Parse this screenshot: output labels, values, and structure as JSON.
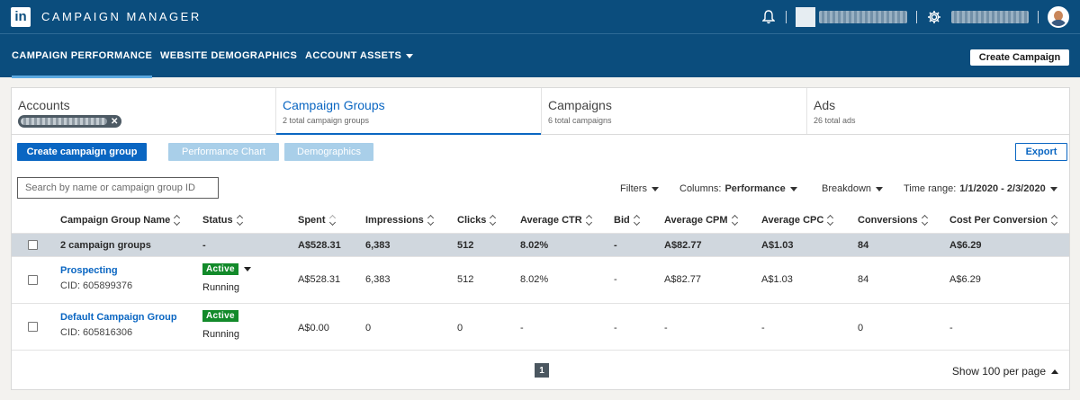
{
  "app": {
    "logo_text": "in",
    "title": "CAMPAIGN MANAGER"
  },
  "topbar": {
    "icons": [
      "bell-icon",
      "gear-icon"
    ],
    "account_name_redacted": true,
    "user_name_redacted": true
  },
  "nav": {
    "items": [
      {
        "label": "CAMPAIGN PERFORMANCE",
        "active": true
      },
      {
        "label": "WEBSITE DEMOGRAPHICS",
        "active": false
      },
      {
        "label": "ACCOUNT ASSETS",
        "active": false,
        "has_dropdown": true
      }
    ],
    "create_campaign_label": "Create Campaign"
  },
  "tabs": [
    {
      "title": "Accounts",
      "subtitle": "",
      "active": false
    },
    {
      "title": "Campaign Groups",
      "subtitle": "2 total campaign groups",
      "active": true
    },
    {
      "title": "Campaigns",
      "subtitle": "6 total campaigns",
      "active": false
    },
    {
      "title": "Ads",
      "subtitle": "26 total ads",
      "active": false
    }
  ],
  "toolbar": {
    "create_group_label": "Create campaign group",
    "performance_chart_label": "Performance Chart",
    "demographics_label": "Demographics",
    "export_label": "Export",
    "search_placeholder": "Search by name or campaign group ID",
    "filters_label": "Filters",
    "columns_prefix": "Columns:",
    "columns_value": "Performance",
    "breakdown_label": "Breakdown",
    "time_range_prefix": "Time range:",
    "time_range_value": "1/1/2020 - 2/3/2020"
  },
  "table": {
    "headers": [
      "Campaign Group Name",
      "Status",
      "Spent",
      "Impressions",
      "Clicks",
      "Average CTR",
      "Bid",
      "Average CPM",
      "Average CPC",
      "Conversions",
      "Cost Per Conversion"
    ],
    "summary": {
      "name": "2 campaign groups",
      "status": "-",
      "spent": "A$528.31",
      "impressions": "6,383",
      "clicks": "512",
      "ctr": "8.02%",
      "bid": "-",
      "cpm": "A$82.77",
      "cpc": "A$1.03",
      "conversions": "84",
      "cpconv": "A$6.29"
    },
    "rows": [
      {
        "name": "Prospecting",
        "cid": "CID: 605899376",
        "badge": "Active",
        "state": "Running",
        "spent": "A$528.31",
        "impressions": "6,383",
        "clicks": "512",
        "ctr": "8.02%",
        "bid": "-",
        "cpm": "A$82.77",
        "cpc": "A$1.03",
        "conversions": "84",
        "cpconv": "A$6.29"
      },
      {
        "name": "Default Campaign Group",
        "cid": "CID: 605816306",
        "badge": "Active",
        "state": "Running",
        "spent": "A$0.00",
        "impressions": "0",
        "clicks": "0",
        "ctr": "-",
        "bid": "-",
        "cpm": "-",
        "cpc": "-",
        "conversions": "0",
        "cpconv": "-"
      }
    ]
  },
  "pagination": {
    "current_page": "1",
    "per_page_label": "Show 100 per page"
  },
  "colors": {
    "brand": "#0b4d7d",
    "accent": "#0a66c2",
    "active_badge": "#128a2a",
    "summary_row": "#d0d7de"
  }
}
